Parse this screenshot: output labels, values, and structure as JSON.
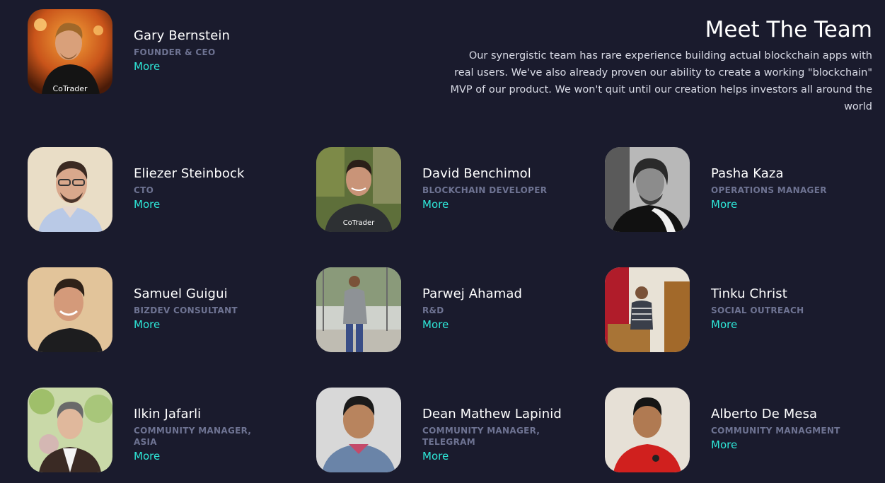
{
  "section": {
    "title": "Meet The Team",
    "description": "Our synergistic team has rare experience building actual blockchain apps with real users. We've also already proven our ability to create a working \"blockchain\" MVP of our product. We won't quit until our creation helps investors all around the world"
  },
  "colors": {
    "background": "#1a1b2d",
    "role_text": "#6e7392",
    "link": "#2ee8d9"
  },
  "members": [
    {
      "name": "Gary Bernstein",
      "role": "FOUNDER & CEO",
      "more": "More",
      "photo_logo": "CoTrader"
    },
    {
      "name": "Eliezer Steinbock",
      "role": "CTO",
      "more": "More"
    },
    {
      "name": "David Benchimol",
      "role": "BLOCKCHAIN DEVELOPER",
      "more": "More",
      "photo_logo": "CoTrader"
    },
    {
      "name": "Pasha Kaza",
      "role": "OPERATIONS MANAGER",
      "more": "More"
    },
    {
      "name": "Samuel Guigui",
      "role": "BIZDEV CONSULTANT",
      "more": "More"
    },
    {
      "name": "Parwej Ahamad",
      "role": "R&D",
      "more": "More"
    },
    {
      "name": "Tinku Christ",
      "role": "SOCIAL OUTREACH",
      "more": "More"
    },
    {
      "name": "Ilkin Jafarli",
      "role": "COMMUNITY MANAGER, ASIA",
      "more": "More"
    },
    {
      "name": "Dean Mathew Lapinid",
      "role": "COMMUNITY MANAGER, TELEGRAM",
      "more": "More"
    },
    {
      "name": "Alberto De Mesa",
      "role": "COMMUNITY MANAGMENT",
      "more": "More"
    }
  ]
}
